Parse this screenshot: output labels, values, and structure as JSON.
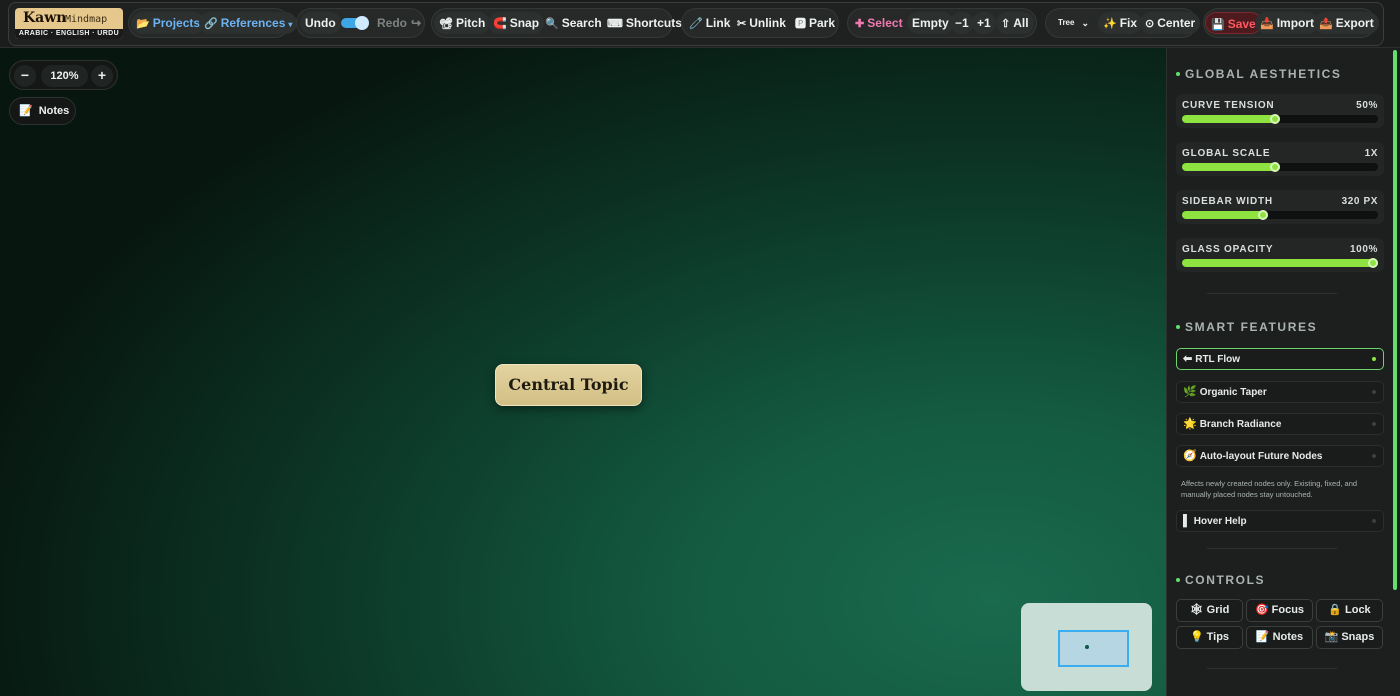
{
  "app": {
    "logo_name": "Kawn",
    "logo_sub": "Mindmap",
    "logo_langs": "ARABIC · ENGLISH · URDU"
  },
  "toolbar": {
    "projects": "Projects",
    "references": "References",
    "undo": "Undo",
    "redo": "Redo",
    "pitch": "Pitch",
    "snap": "Snap",
    "search": "Search",
    "shortcuts": "Shortcuts",
    "link": "Link",
    "unlink": "Unlink",
    "park": "Park",
    "select": "Select",
    "empty": "Empty",
    "minus_one": "−1",
    "plus_one": "+1",
    "all": "All",
    "layout_select": "Tree",
    "fix": "Fix",
    "center": "Center",
    "save": "Save",
    "import": "Import",
    "export": "Export"
  },
  "zoom": {
    "minus": "−",
    "value": "120%",
    "plus": "+"
  },
  "notes_chip": "Notes",
  "canvas": {
    "central_topic": "Central Topic"
  },
  "sidebar": {
    "aesthetics_title": "GLOBAL AESTHETICS",
    "sliders": [
      {
        "label": "CURVE TENSION",
        "value": "50%",
        "level": 0.5
      },
      {
        "label": "GLOBAL SCALE",
        "value": "1X",
        "level": 0.5
      },
      {
        "label": "SIDEBAR WIDTH",
        "value": "320 PX",
        "level": 0.44
      },
      {
        "label": "GLASS OPACITY",
        "value": "100%",
        "level": 1.0
      }
    ],
    "features_title": "SMART FEATURES",
    "features": [
      {
        "label": "RTL Flow",
        "on": true
      },
      {
        "label": "Organic Taper",
        "on": false
      },
      {
        "label": "Branch Radiance",
        "on": false
      },
      {
        "label": "Auto-layout Future Nodes",
        "on": false
      }
    ],
    "feature_note": "Affects newly created nodes only. Existing, fixed, and manually placed nodes stay untouched.",
    "hover_help": "Hover Help",
    "controls_title": "CONTROLS",
    "controls": [
      "Grid",
      "Focus",
      "Lock",
      "Tips",
      "Notes",
      "Snaps"
    ]
  },
  "colors": {
    "accent_green": "#8fe341",
    "save_red": "#ff5a62",
    "link_blue": "#6db3f2",
    "select_pink": "#f07ab0",
    "node_fill": "#d9c68f"
  }
}
